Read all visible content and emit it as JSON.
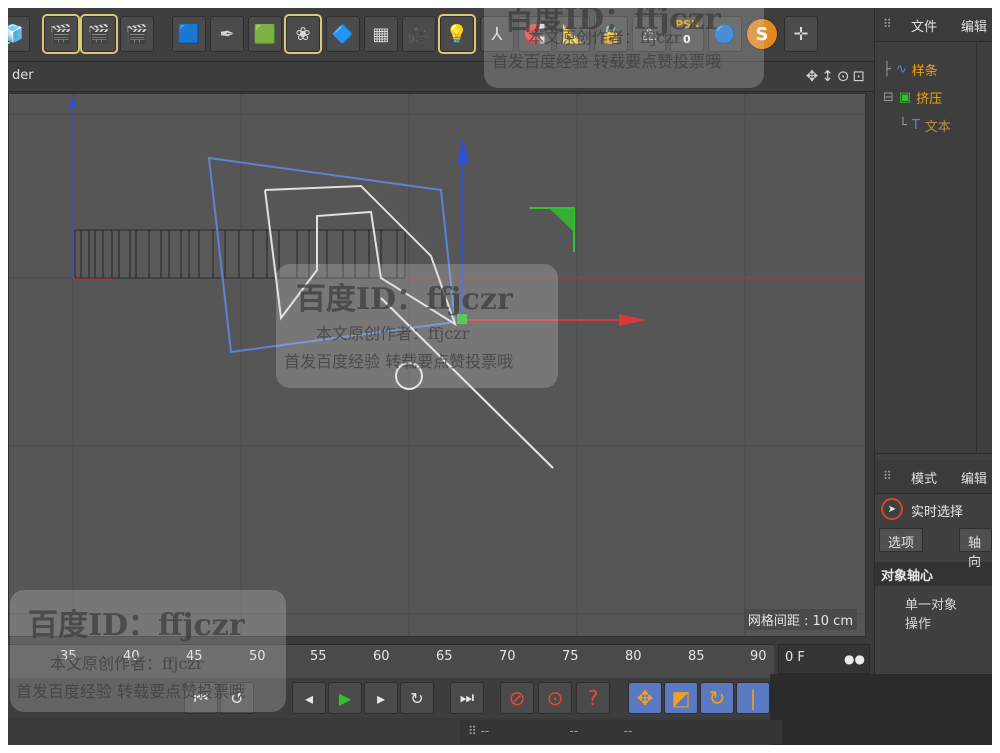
{
  "viewport": {
    "title": "der",
    "nav_icons": "✥↕⊙⊡",
    "grid_spacing": "网格间距 : 10 cm"
  },
  "object_manager": {
    "tab_file": "文件",
    "tab_edit": "编辑",
    "items": [
      {
        "label": "样条"
      },
      {
        "label": "挤压"
      },
      {
        "label": "文本"
      }
    ]
  },
  "attribute_manager": {
    "tab_mode": "模式",
    "tab_edit": "编辑",
    "live_selection": "实时选择",
    "tab_options": "选项",
    "tab_axis": "轴向",
    "section_title": "对象轴心",
    "single_object": "单一对象操作"
  },
  "timeline": {
    "ticks": [
      "35",
      "40",
      "45",
      "50",
      "55",
      "60",
      "65",
      "70",
      "75",
      "80",
      "85",
      "90"
    ],
    "current_frame": "0 F"
  },
  "toolbar": {
    "psr_label": "PSR",
    "psr_value": "0"
  },
  "watermark": {
    "id_line": "百度ID：ffjczr",
    "author_line": "本文原创作者：ffjczr",
    "publish_line": "首发百度经验 转载要点赞投票哦"
  },
  "colors": {
    "spline_blue": "#5b84d8",
    "axis_red": "#d63a3a",
    "axis_blue": "#2f4fd6",
    "axis_green": "#2fc22f",
    "label_orange": "#f4a100"
  }
}
